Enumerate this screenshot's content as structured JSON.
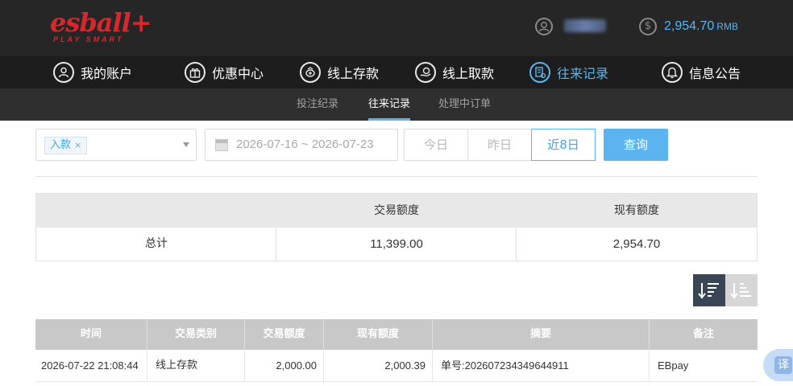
{
  "brand": {
    "logo": "esball+",
    "tagline": "PLAY SMART"
  },
  "account": {
    "balance": "2,954.70",
    "currency": "RMB"
  },
  "nav": [
    {
      "label": "我的账户",
      "icon": "user-circle-icon"
    },
    {
      "label": "优惠中心",
      "icon": "gift-icon"
    },
    {
      "label": "线上存款",
      "icon": "deposit-icon"
    },
    {
      "label": "线上取款",
      "icon": "withdraw-icon"
    },
    {
      "label": "往来记录",
      "icon": "record-icon",
      "active": true
    },
    {
      "label": "信息公告",
      "icon": "bell-icon"
    }
  ],
  "subnav": [
    {
      "label": "投注纪录"
    },
    {
      "label": "往来记录",
      "active": true
    },
    {
      "label": "处理中订单"
    }
  ],
  "filter": {
    "type_tag": "入款",
    "date_range": "2026-07-16 ~ 2026-07-23",
    "quick": [
      "今日",
      "昨日",
      "近8日"
    ],
    "quick_selected": "近8日",
    "query_label": "查询"
  },
  "summary": {
    "headers": [
      "",
      "交易额度",
      "现有额度"
    ],
    "total_label": "总计",
    "total_amount": "11,399.00",
    "current_amount": "2,954.70"
  },
  "table": {
    "headers": [
      "时间",
      "交易类别",
      "交易额度",
      "现有额度",
      "摘要",
      "备注"
    ],
    "rows": [
      {
        "time": "2026-07-22 21:08:44",
        "type": "线上存款",
        "amount": "2,000.00",
        "balance": "2,000.39",
        "summary": "单号:202607234349644911",
        "note": "EBpay"
      }
    ]
  },
  "widgets": {
    "translate": "译"
  },
  "colors": {
    "accent": "#5bb4f0",
    "brand_red": "#d9262b",
    "header_bg": "#262626"
  }
}
